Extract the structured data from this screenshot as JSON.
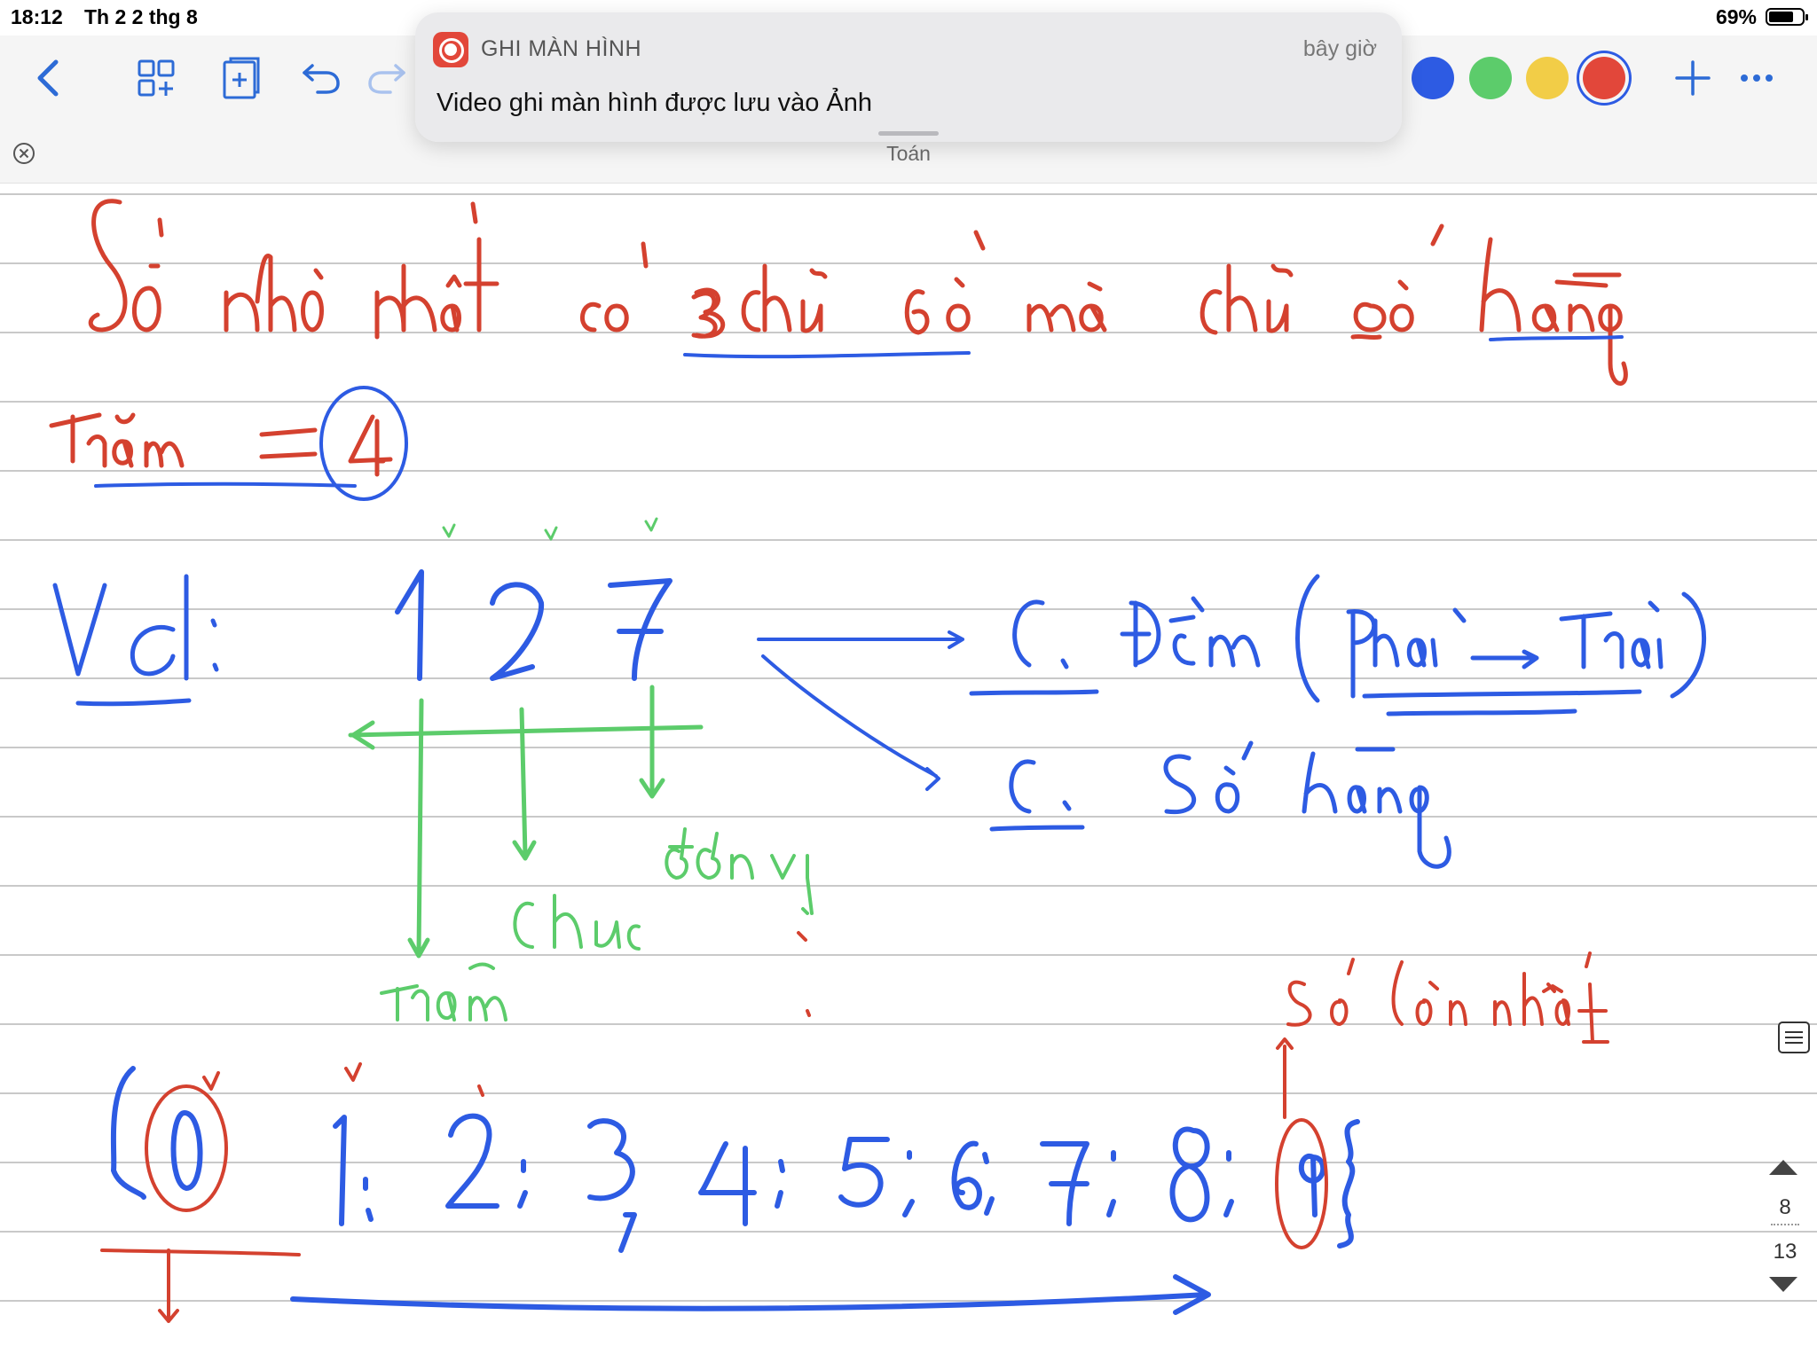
{
  "status_bar": {
    "time": "18:12",
    "date": "Th 2 2 thg 8",
    "battery_percent": "69%"
  },
  "toolbar": {
    "icons": [
      "chevron-left-icon",
      "grid-add-icon",
      "add-page-icon",
      "undo-icon",
      "redo-icon",
      "plus-icon",
      "more-icon"
    ],
    "colors": [
      "#2d5be3",
      "#5ccc6b",
      "#f2cd47",
      "#e2473a"
    ],
    "selected_color": "#e2473a"
  },
  "notification": {
    "app_name": "GHI MÀN HÌNH",
    "time": "bây giờ",
    "message": "Video ghi màn hình được lưu vào Ảnh"
  },
  "document": {
    "title": "Toán"
  },
  "pager": {
    "current": "8",
    "total": "13"
  },
  "handwriting": {
    "line1": "Số nhỏ nhất có 3 chữ số mà chữ số hàng",
    "line2": "trăm = 4",
    "example_label": "VD:",
    "example_number": "127",
    "method1": "C1: Đếm (Phải → Trái)",
    "method2": "C2: Số hàng",
    "place_units": "đơn vị",
    "place_tens": "chục",
    "place_hundreds": "trăm",
    "largest_digit_label": "Số lớn nhất",
    "digit_set": "{0; 1; 2; 3; 4; 5; 6; 7; 8; 9}"
  }
}
